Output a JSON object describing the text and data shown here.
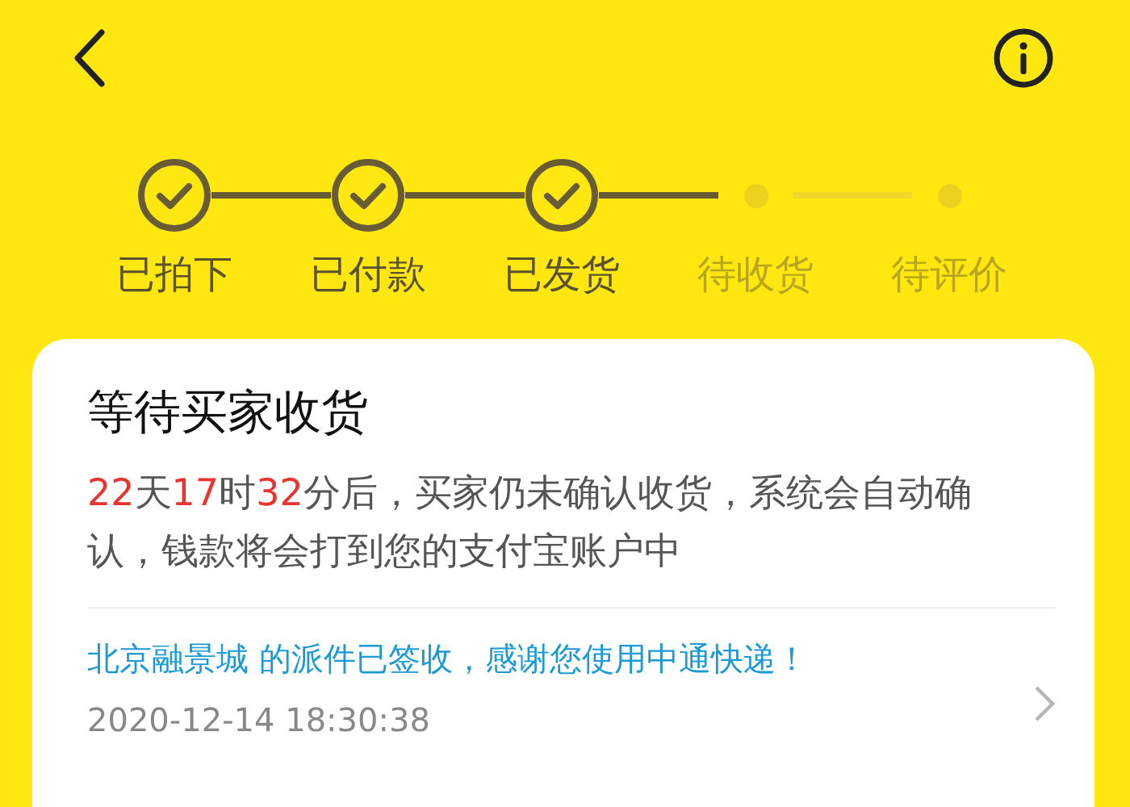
{
  "steps": [
    {
      "label": "已拍下",
      "done": true
    },
    {
      "label": "已付款",
      "done": true
    },
    {
      "label": "已发货",
      "done": true
    },
    {
      "label": "待收货",
      "done": false
    },
    {
      "label": "待评价",
      "done": false
    }
  ],
  "card": {
    "title": "等待买家收货",
    "countdown": [
      {
        "text": "22",
        "highlight": true
      },
      {
        "text": "天",
        "highlight": false
      },
      {
        "text": "17",
        "highlight": true
      },
      {
        "text": "时",
        "highlight": false
      },
      {
        "text": "32",
        "highlight": true
      },
      {
        "text": "分后，买家仍未确认收货，系统会自动确认，钱款将会打到您的支付宝账户中",
        "highlight": false
      }
    ],
    "logistics": {
      "message": "北京融景城 的派件已签收，感谢您使用中通快递！",
      "time": "2020-12-14 18:30:38"
    }
  }
}
